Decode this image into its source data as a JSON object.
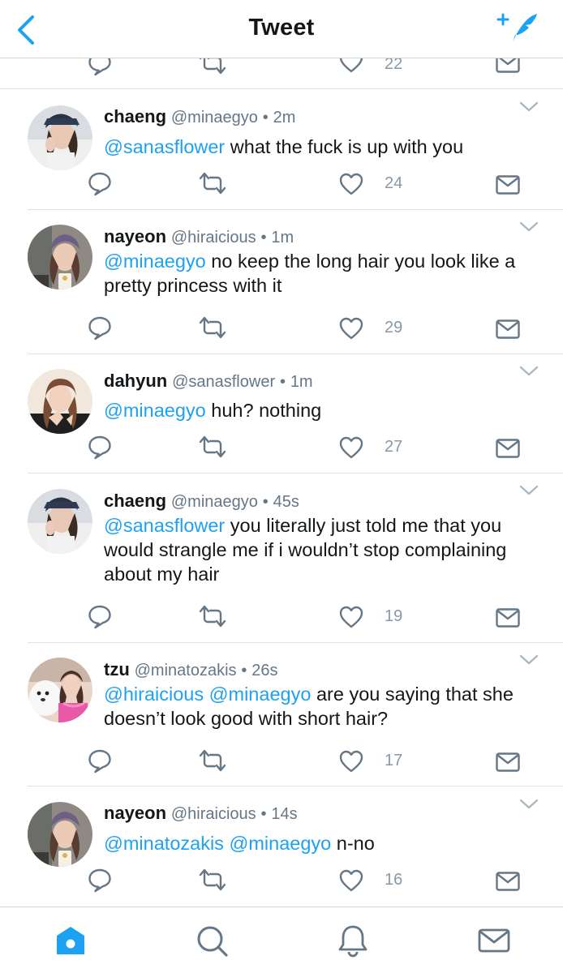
{
  "header": {
    "title": "Tweet",
    "back_icon": "back-chevron-icon",
    "compose_icon": "compose-tweet-icon"
  },
  "partial_row": {
    "like_count": "22"
  },
  "colors": {
    "accent": "#1da1f2",
    "secondary": "#657786",
    "icon": "#657786"
  },
  "tweets": [
    {
      "name": "chaeng",
      "handle": "@minaegyo",
      "dot": "•",
      "time": "2m",
      "mentions": [
        "@sanasflower"
      ],
      "text": "what the fuck is up with you",
      "likes": "24"
    },
    {
      "name": "nayeon",
      "handle": "@hiraicious",
      "dot": "•",
      "time": "1m",
      "mentions": [
        "@minaegyo"
      ],
      "text": "no keep the long hair you look like a pretty princess with it",
      "likes": "29"
    },
    {
      "name": "dahyun",
      "handle": "@sanasflower",
      "dot": "•",
      "time": "1m",
      "mentions": [
        "@minaegyo"
      ],
      "text": "huh? nothing",
      "likes": "27"
    },
    {
      "name": "chaeng",
      "handle": "@minaegyo",
      "dot": "•",
      "time": "45s",
      "mentions": [
        "@sanasflower"
      ],
      "text": "you literally just told me that you would strangle me if i wouldn’t stop complaining about my hair",
      "likes": "19"
    },
    {
      "name": "tzu",
      "handle": "@minatozakis",
      "dot": "•",
      "time": "26s",
      "mentions": [
        "@hiraicious",
        "@minaegyo"
      ],
      "text": "are you saying that she doesn’t look good with short hair?",
      "likes": "17"
    },
    {
      "name": "nayeon",
      "handle": "@hiraicious",
      "dot": "•",
      "time": "14s",
      "mentions": [
        "@minatozakis",
        "@minaegyo"
      ],
      "text": "n-no",
      "likes": "16"
    }
  ],
  "bottom_nav": {
    "items": [
      {
        "icon": "home-icon",
        "active": true
      },
      {
        "icon": "search-icon",
        "active": false
      },
      {
        "icon": "notifications-icon",
        "active": false
      },
      {
        "icon": "messages-icon",
        "active": false
      }
    ]
  }
}
